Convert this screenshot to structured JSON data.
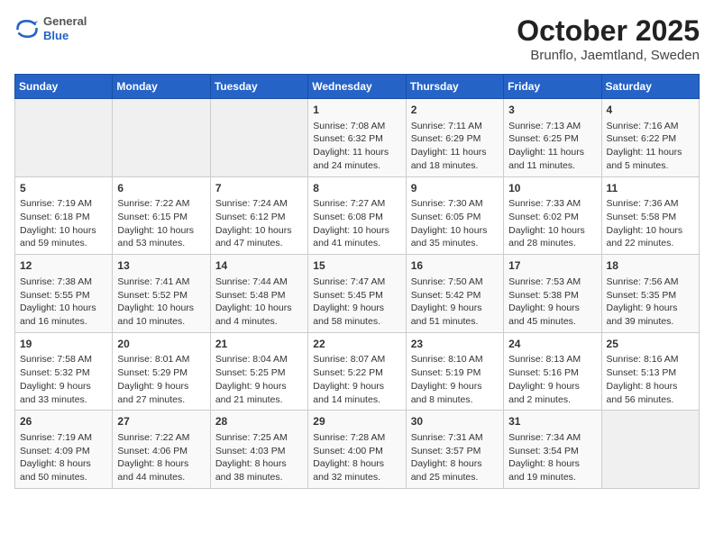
{
  "header": {
    "logo": {
      "general": "General",
      "blue": "Blue"
    },
    "title": "October 2025",
    "location": "Brunflo, Jaemtland, Sweden"
  },
  "weekdays": [
    "Sunday",
    "Monday",
    "Tuesday",
    "Wednesday",
    "Thursday",
    "Friday",
    "Saturday"
  ],
  "weeks": [
    [
      {
        "day": "",
        "content": ""
      },
      {
        "day": "",
        "content": ""
      },
      {
        "day": "",
        "content": ""
      },
      {
        "day": "1",
        "content": "Sunrise: 7:08 AM\nSunset: 6:32 PM\nDaylight: 11 hours and 24 minutes."
      },
      {
        "day": "2",
        "content": "Sunrise: 7:11 AM\nSunset: 6:29 PM\nDaylight: 11 hours and 18 minutes."
      },
      {
        "day": "3",
        "content": "Sunrise: 7:13 AM\nSunset: 6:25 PM\nDaylight: 11 hours and 11 minutes."
      },
      {
        "day": "4",
        "content": "Sunrise: 7:16 AM\nSunset: 6:22 PM\nDaylight: 11 hours and 5 minutes."
      }
    ],
    [
      {
        "day": "5",
        "content": "Sunrise: 7:19 AM\nSunset: 6:18 PM\nDaylight: 10 hours and 59 minutes."
      },
      {
        "day": "6",
        "content": "Sunrise: 7:22 AM\nSunset: 6:15 PM\nDaylight: 10 hours and 53 minutes."
      },
      {
        "day": "7",
        "content": "Sunrise: 7:24 AM\nSunset: 6:12 PM\nDaylight: 10 hours and 47 minutes."
      },
      {
        "day": "8",
        "content": "Sunrise: 7:27 AM\nSunset: 6:08 PM\nDaylight: 10 hours and 41 minutes."
      },
      {
        "day": "9",
        "content": "Sunrise: 7:30 AM\nSunset: 6:05 PM\nDaylight: 10 hours and 35 minutes."
      },
      {
        "day": "10",
        "content": "Sunrise: 7:33 AM\nSunset: 6:02 PM\nDaylight: 10 hours and 28 minutes."
      },
      {
        "day": "11",
        "content": "Sunrise: 7:36 AM\nSunset: 5:58 PM\nDaylight: 10 hours and 22 minutes."
      }
    ],
    [
      {
        "day": "12",
        "content": "Sunrise: 7:38 AM\nSunset: 5:55 PM\nDaylight: 10 hours and 16 minutes."
      },
      {
        "day": "13",
        "content": "Sunrise: 7:41 AM\nSunset: 5:52 PM\nDaylight: 10 hours and 10 minutes."
      },
      {
        "day": "14",
        "content": "Sunrise: 7:44 AM\nSunset: 5:48 PM\nDaylight: 10 hours and 4 minutes."
      },
      {
        "day": "15",
        "content": "Sunrise: 7:47 AM\nSunset: 5:45 PM\nDaylight: 9 hours and 58 minutes."
      },
      {
        "day": "16",
        "content": "Sunrise: 7:50 AM\nSunset: 5:42 PM\nDaylight: 9 hours and 51 minutes."
      },
      {
        "day": "17",
        "content": "Sunrise: 7:53 AM\nSunset: 5:38 PM\nDaylight: 9 hours and 45 minutes."
      },
      {
        "day": "18",
        "content": "Sunrise: 7:56 AM\nSunset: 5:35 PM\nDaylight: 9 hours and 39 minutes."
      }
    ],
    [
      {
        "day": "19",
        "content": "Sunrise: 7:58 AM\nSunset: 5:32 PM\nDaylight: 9 hours and 33 minutes."
      },
      {
        "day": "20",
        "content": "Sunrise: 8:01 AM\nSunset: 5:29 PM\nDaylight: 9 hours and 27 minutes."
      },
      {
        "day": "21",
        "content": "Sunrise: 8:04 AM\nSunset: 5:25 PM\nDaylight: 9 hours and 21 minutes."
      },
      {
        "day": "22",
        "content": "Sunrise: 8:07 AM\nSunset: 5:22 PM\nDaylight: 9 hours and 14 minutes."
      },
      {
        "day": "23",
        "content": "Sunrise: 8:10 AM\nSunset: 5:19 PM\nDaylight: 9 hours and 8 minutes."
      },
      {
        "day": "24",
        "content": "Sunrise: 8:13 AM\nSunset: 5:16 PM\nDaylight: 9 hours and 2 minutes."
      },
      {
        "day": "25",
        "content": "Sunrise: 8:16 AM\nSunset: 5:13 PM\nDaylight: 8 hours and 56 minutes."
      }
    ],
    [
      {
        "day": "26",
        "content": "Sunrise: 7:19 AM\nSunset: 4:09 PM\nDaylight: 8 hours and 50 minutes."
      },
      {
        "day": "27",
        "content": "Sunrise: 7:22 AM\nSunset: 4:06 PM\nDaylight: 8 hours and 44 minutes."
      },
      {
        "day": "28",
        "content": "Sunrise: 7:25 AM\nSunset: 4:03 PM\nDaylight: 8 hours and 38 minutes."
      },
      {
        "day": "29",
        "content": "Sunrise: 7:28 AM\nSunset: 4:00 PM\nDaylight: 8 hours and 32 minutes."
      },
      {
        "day": "30",
        "content": "Sunrise: 7:31 AM\nSunset: 3:57 PM\nDaylight: 8 hours and 25 minutes."
      },
      {
        "day": "31",
        "content": "Sunrise: 7:34 AM\nSunset: 3:54 PM\nDaylight: 8 hours and 19 minutes."
      },
      {
        "day": "",
        "content": ""
      }
    ]
  ]
}
